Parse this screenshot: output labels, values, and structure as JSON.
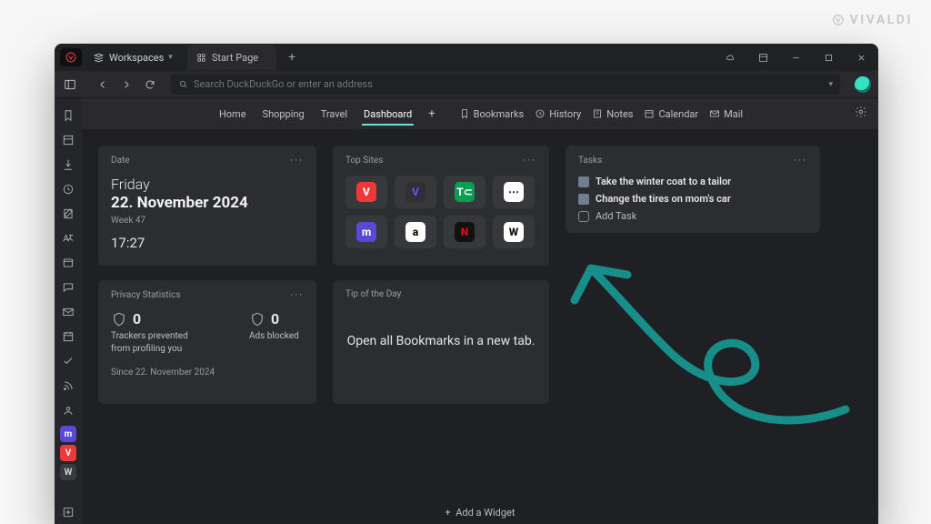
{
  "brand": "VIVALDI",
  "workspaces_label": "Workspaces",
  "tab_title": "Start Page",
  "window_controls": {
    "cloud": "cloud",
    "minimize": "minimize",
    "maximize": "maximize",
    "close": "close"
  },
  "address_placeholder": "Search DuckDuckGo or enter an address",
  "speed_dial": {
    "tabs": [
      "Home",
      "Shopping",
      "Travel",
      "Dashboard"
    ],
    "active_index": 3
  },
  "quicklinks": {
    "bookmarks": "Bookmarks",
    "history": "History",
    "notes": "Notes",
    "calendar": "Calendar",
    "mail": "Mail"
  },
  "sidebar_icons": [
    "bookmarks",
    "panel",
    "downloads",
    "history",
    "notes",
    "rocket",
    "sessions",
    "mail",
    "feed-inbox",
    "calendar",
    "tasks",
    "feeds",
    "contacts"
  ],
  "sidebar_pinned": [
    {
      "name": "mastodon",
      "bg": "#5b48d8",
      "fg": "#ffffff",
      "glyph": "m"
    },
    {
      "name": "vivaldi",
      "bg": "#ef3939",
      "fg": "#ffffff",
      "glyph": "V"
    },
    {
      "name": "wikipedia",
      "bg": "#3a3b3e",
      "fg": "#cfcfcf",
      "glyph": "W"
    }
  ],
  "cards": {
    "date": {
      "title": "Date",
      "day": "Friday",
      "full": "22. November 2024",
      "week": "Week 47",
      "time": "17:27"
    },
    "topsites": {
      "title": "Top Sites",
      "tiles": [
        {
          "name": "Vivaldi",
          "bg": "#ef3939",
          "fg": "#ffffff",
          "glyph": "V"
        },
        {
          "name": "Vivaldi Forum",
          "bg": "#2f2f34",
          "fg": "#6b4cff",
          "glyph": "V"
        },
        {
          "name": "TechCrunch",
          "bg": "#0a9e55",
          "fg": "#ffffff",
          "glyph": "T⊂"
        },
        {
          "name": "DotGrid",
          "bg": "#ffffff",
          "fg": "#1a1a1a",
          "glyph": "⋯"
        },
        {
          "name": "Mastodon",
          "bg": "#5b48d8",
          "fg": "#ffffff",
          "glyph": "m"
        },
        {
          "name": "Amazon",
          "bg": "#ffffff",
          "fg": "#000000",
          "glyph": "a"
        },
        {
          "name": "Netflix",
          "bg": "#111111",
          "fg": "#e50914",
          "glyph": "N"
        },
        {
          "name": "Wikipedia",
          "bg": "#ffffff",
          "fg": "#111111",
          "glyph": "W"
        }
      ]
    },
    "tasks": {
      "title": "Tasks",
      "items": [
        "Take the winter coat to a tailor",
        "Change the tires on mom's car"
      ],
      "add_label": "Add Task"
    },
    "privacy": {
      "title": "Privacy Statistics",
      "trackers": {
        "count": 0,
        "label": "Trackers prevented from profiling you"
      },
      "ads": {
        "count": 0,
        "label": "Ads blocked"
      },
      "since": "Since 22. November 2024"
    },
    "tip": {
      "title": "Tip of the Day",
      "body": "Open all Bookmarks in a new tab."
    }
  },
  "add_widget_label": "Add a Widget",
  "arrow_color": "#188e8a"
}
